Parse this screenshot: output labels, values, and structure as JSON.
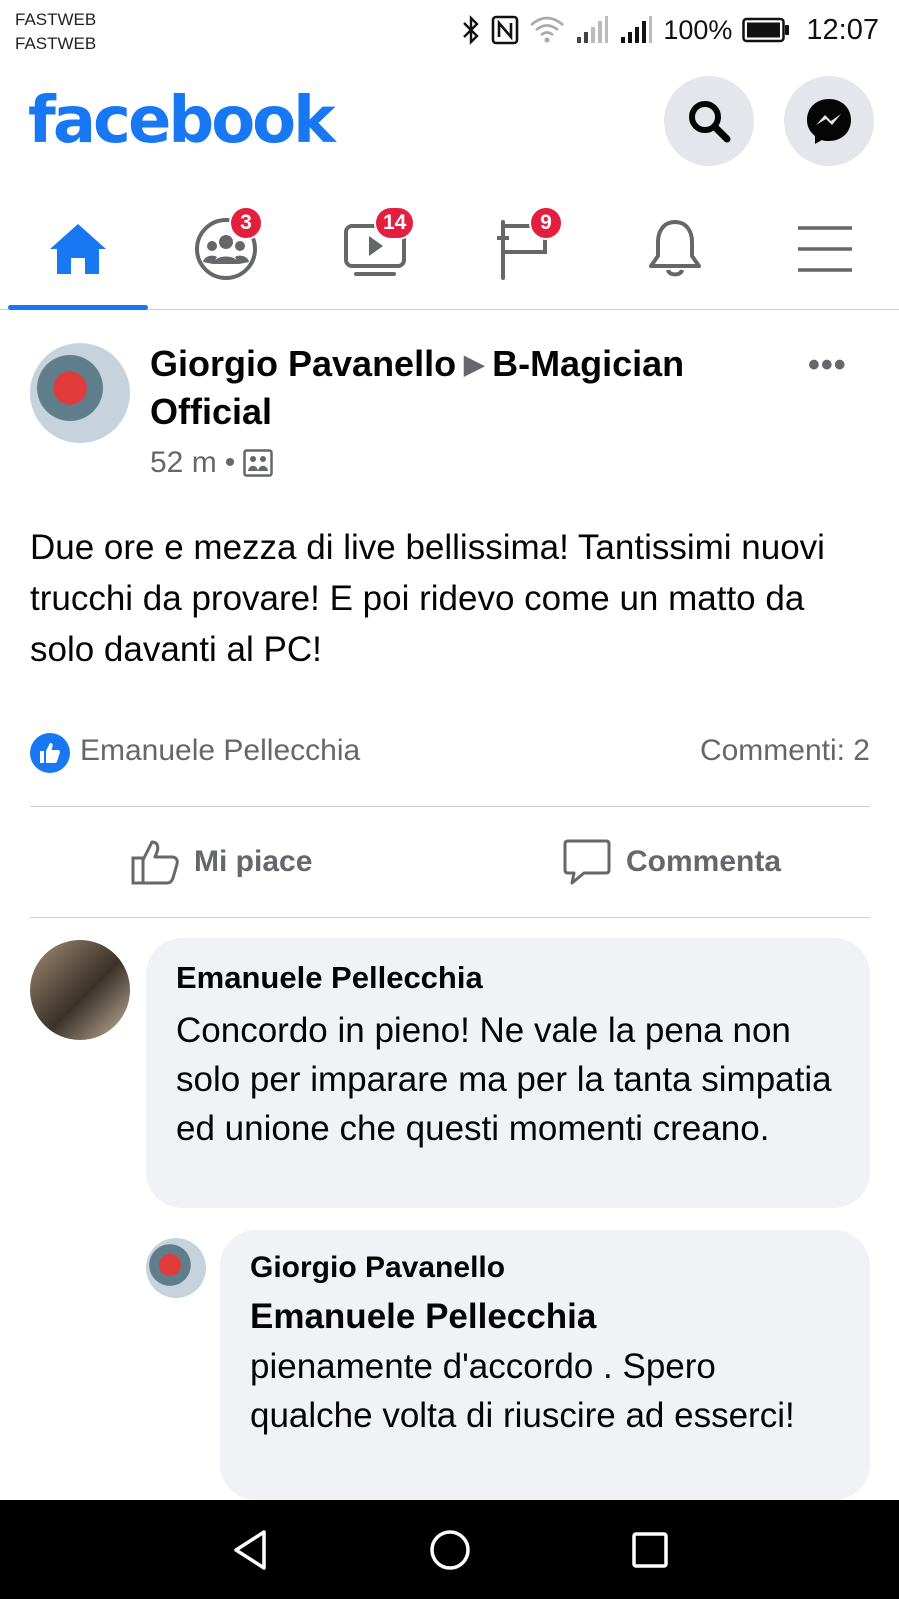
{
  "status_bar": {
    "carrier_line1": "FASTWEB",
    "carrier_line2": "FASTWEB",
    "battery": "100%",
    "time": "12:07",
    "icons": [
      "bluetooth-icon",
      "nfc-icon",
      "wifi-icon",
      "signal-icon",
      "signal-icon",
      "battery-icon"
    ]
  },
  "header": {
    "logo": "facebook",
    "brand_color": "#1877f2",
    "icons": [
      "search-icon",
      "messenger-icon"
    ]
  },
  "nav": {
    "tabs": [
      {
        "name": "home",
        "icon": "home-icon",
        "badge": "",
        "active": true
      },
      {
        "name": "groups",
        "icon": "groups-icon",
        "badge": "3",
        "active": false
      },
      {
        "name": "watch",
        "icon": "watch-icon",
        "badge": "14",
        "active": false
      },
      {
        "name": "pages",
        "icon": "flag-icon",
        "badge": "9",
        "active": false
      },
      {
        "name": "notifications",
        "icon": "bell-icon",
        "badge": "",
        "active": false
      },
      {
        "name": "menu",
        "icon": "menu-icon",
        "badge": "",
        "active": false
      }
    ]
  },
  "post": {
    "author": "Giorgio Pavanello",
    "target": "B-Magician Official",
    "time": "52 m",
    "privacy_icon": "group-privacy-icon",
    "text": "Due ore e mezza di live bellissima! Tantissimi nuovi trucchi da provare! E poi ridevo come un matto da solo davanti al PC!",
    "reactor": "Emanuele Pellecchia",
    "comments_count": "Commenti: 2",
    "actions": {
      "like": "Mi piace",
      "comment": "Commenta"
    }
  },
  "comments": [
    {
      "author": "Emanuele Pellecchia",
      "text": "Concordo in pieno! Ne vale la pena non solo per imparare ma per la tanta simpatia ed unione che questi momenti creano."
    },
    {
      "author": "Giorgio Pavanello",
      "mention": "Emanuele Pellecchia",
      "text": "pienamente d'accordo . Spero qualche volta di riuscire ad esserci!"
    }
  ]
}
